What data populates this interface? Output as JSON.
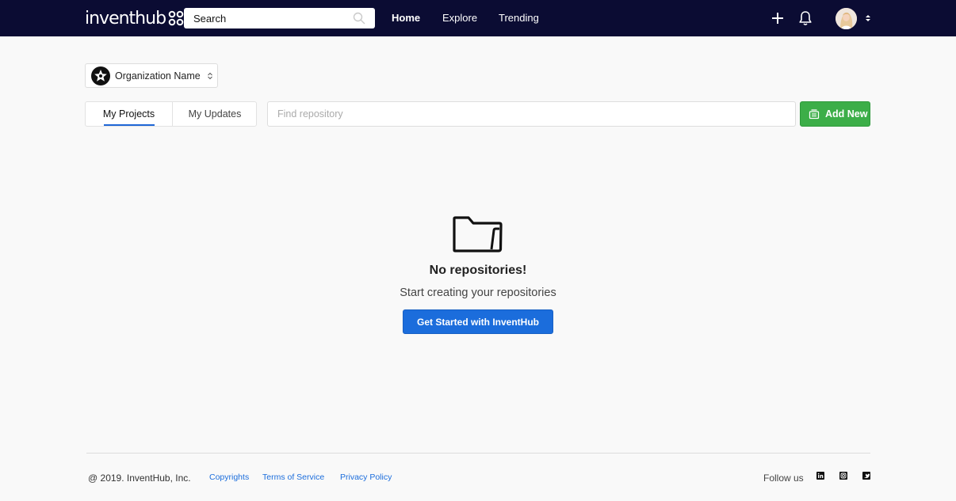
{
  "brand": {
    "logo_text": "inventhub"
  },
  "topbar": {
    "search_placeholder": "Search",
    "nav": [
      {
        "label": "Home",
        "active": true
      },
      {
        "label": "Explore",
        "active": false
      },
      {
        "label": "Trending",
        "active": false
      }
    ],
    "icons": [
      "plus-icon",
      "bell-icon",
      "avatar",
      "caret-icon"
    ]
  },
  "org": {
    "name": "Organization Name"
  },
  "tabs": [
    {
      "label": "My Projects",
      "active": true
    },
    {
      "label": "My Updates",
      "active": false
    }
  ],
  "find": {
    "placeholder": "Find repository"
  },
  "add_button": {
    "label": "Add New"
  },
  "empty_state": {
    "title": "No repositories!",
    "subtitle": "Start creating your repositories",
    "cta": "Get Started with InventHub"
  },
  "footer": {
    "copyright": "@ 2019. InventHub, Inc.",
    "links": [
      "Copyrights",
      "Terms of Service",
      "Privacy Policy"
    ],
    "follow": "Follow us",
    "social": [
      "linkedin-icon",
      "instagram-icon",
      "twitter-icon"
    ]
  },
  "colors": {
    "topbar": "#0b0c33",
    "accent_blue": "#1b6ddc",
    "accent_green": "#3cae48",
    "background": "#f9f9f9"
  }
}
